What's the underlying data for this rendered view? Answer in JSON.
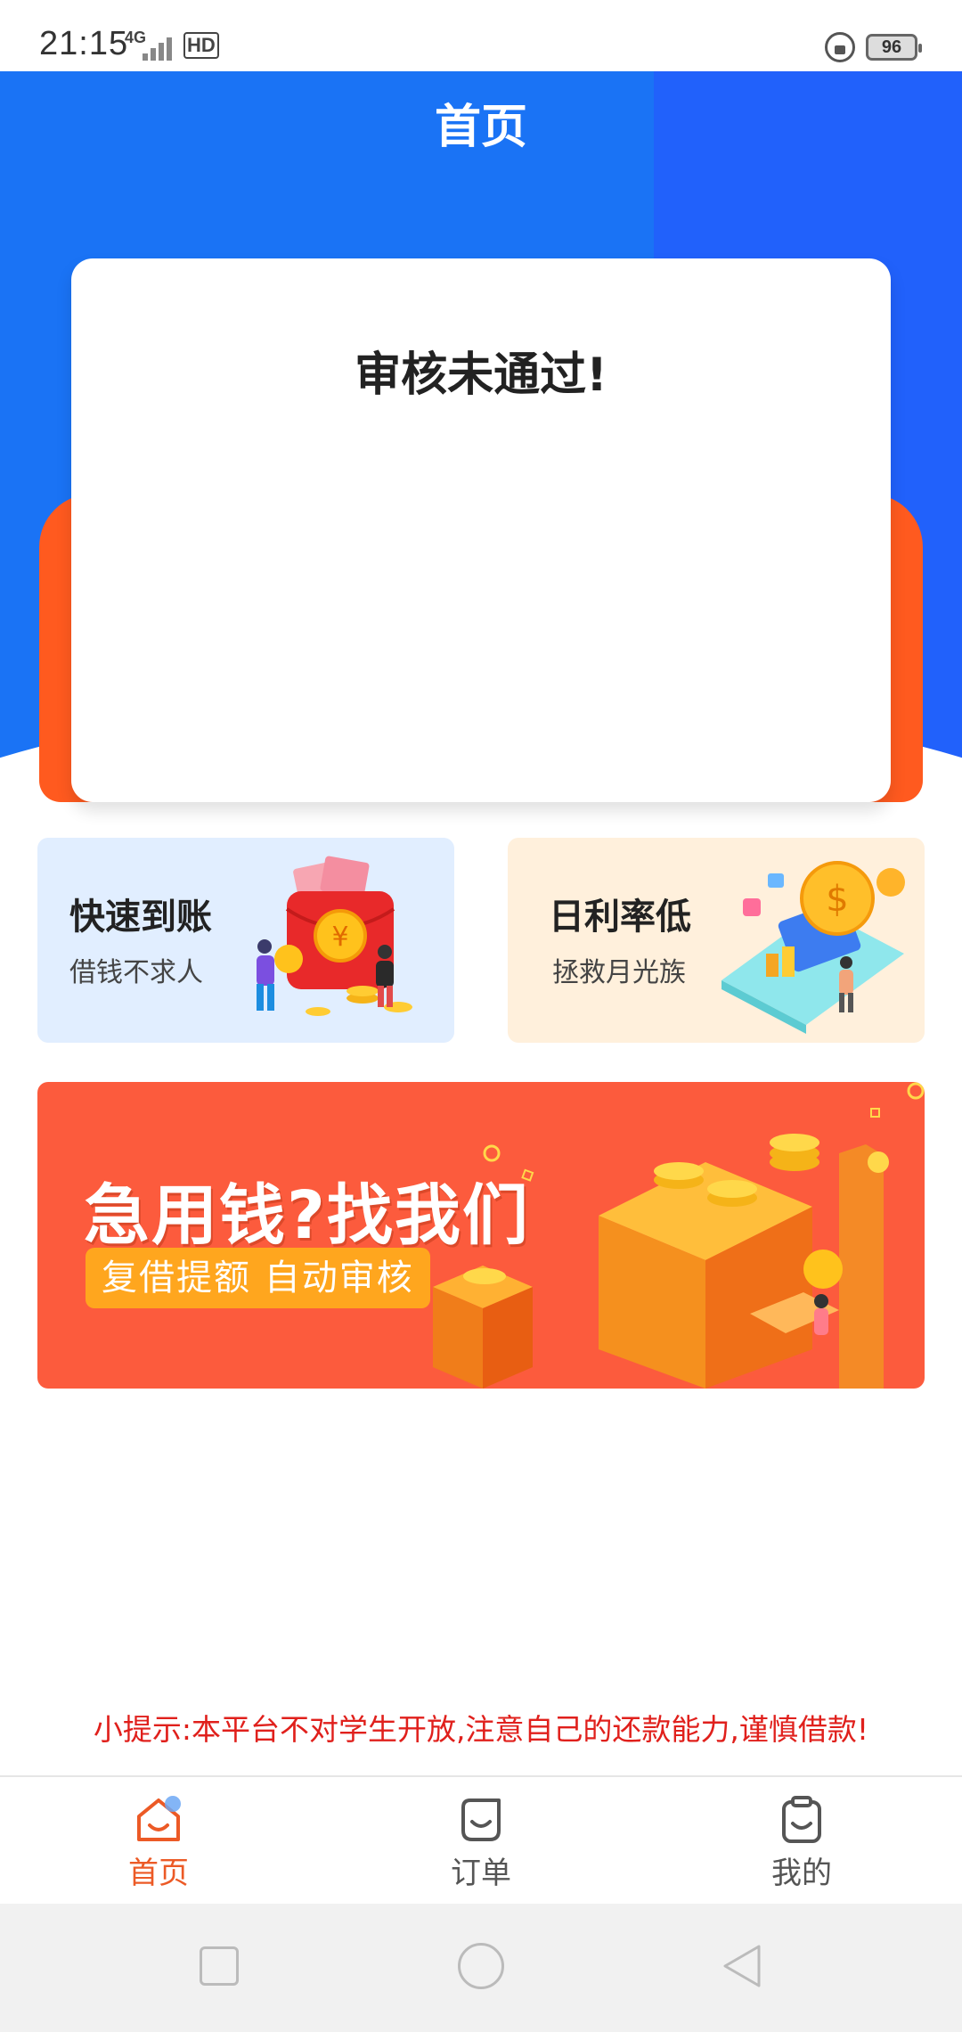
{
  "status_bar": {
    "time": "21:15",
    "network": "4G",
    "hd_badge": "HD",
    "battery": "96"
  },
  "header": {
    "title": "首页"
  },
  "status_card": {
    "title": "审核未通过!"
  },
  "features": [
    {
      "title": "快速到账",
      "subtitle": "借钱不求人",
      "icon": "red-envelope-coins-illustration"
    },
    {
      "title": "日利率低",
      "subtitle": "拯救月光族",
      "icon": "phone-coins-illustration"
    }
  ],
  "banner": {
    "title": "急用钱?找我们",
    "tag": "复借提额 自动审核"
  },
  "tip": "小提示:本平台不对学生开放,注意自己的还款能力,谨慎借款!",
  "tabbar": {
    "items": [
      {
        "label": "首页",
        "icon": "home-icon",
        "active": true
      },
      {
        "label": "订单",
        "icon": "order-icon",
        "active": false
      },
      {
        "label": "我的",
        "icon": "mine-icon",
        "active": false
      }
    ]
  },
  "colors": {
    "brand_blue": "#1a73f5",
    "accent_orange": "#ff5a1f",
    "active_tab": "#ec5a26",
    "tip_red": "#e0201c",
    "banner_bg": "#fc5b3d"
  }
}
